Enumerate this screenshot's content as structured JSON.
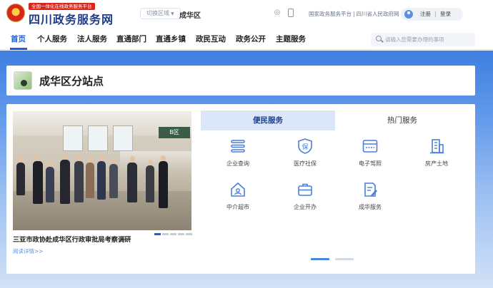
{
  "header": {
    "slogan": "全国一体化在线政务服务平台",
    "site_name": "四川政务服务网",
    "region_switch": "切换区域",
    "region_name": "成华区",
    "links": [
      "国家政务服务平台",
      "四川省人民政府网"
    ],
    "register": "注册",
    "login": "登录"
  },
  "nav": {
    "items": [
      "首页",
      "个人服务",
      "法人服务",
      "直通部门",
      "直通乡镇",
      "政民互动",
      "政务公开",
      "主题服务"
    ],
    "search_placeholder": "请输入您需要办理的事项"
  },
  "station": {
    "title": "成华区分站点"
  },
  "news": {
    "title": "三亚市政协赴成华区行政审批局考察调研",
    "more": "阅读详情>>",
    "photo_sign": "B区",
    "slide_count": 5,
    "active_slide": 1
  },
  "services": {
    "tabs": [
      "便民服务",
      "热门服务"
    ],
    "active_tab": "便民服务",
    "items": [
      {
        "label": "企业查询",
        "icon": "list-icon"
      },
      {
        "label": "医疗社保",
        "icon": "shield-icon"
      },
      {
        "label": "电子驾照",
        "icon": "card-icon"
      },
      {
        "label": "房产土地",
        "icon": "building-icon"
      },
      {
        "label": "中介超市",
        "icon": "house-icon"
      },
      {
        "label": "企业开办",
        "icon": "briefcase-icon"
      },
      {
        "label": "成华服务",
        "icon": "document-edit-icon"
      }
    ],
    "pages": 2,
    "active_page": 1
  },
  "colors": {
    "brand_blue": "#1d5fd6",
    "site_name": "#1f3c88",
    "slogan_red": "#d8261d",
    "icon_blue": "#4a7fdb"
  }
}
